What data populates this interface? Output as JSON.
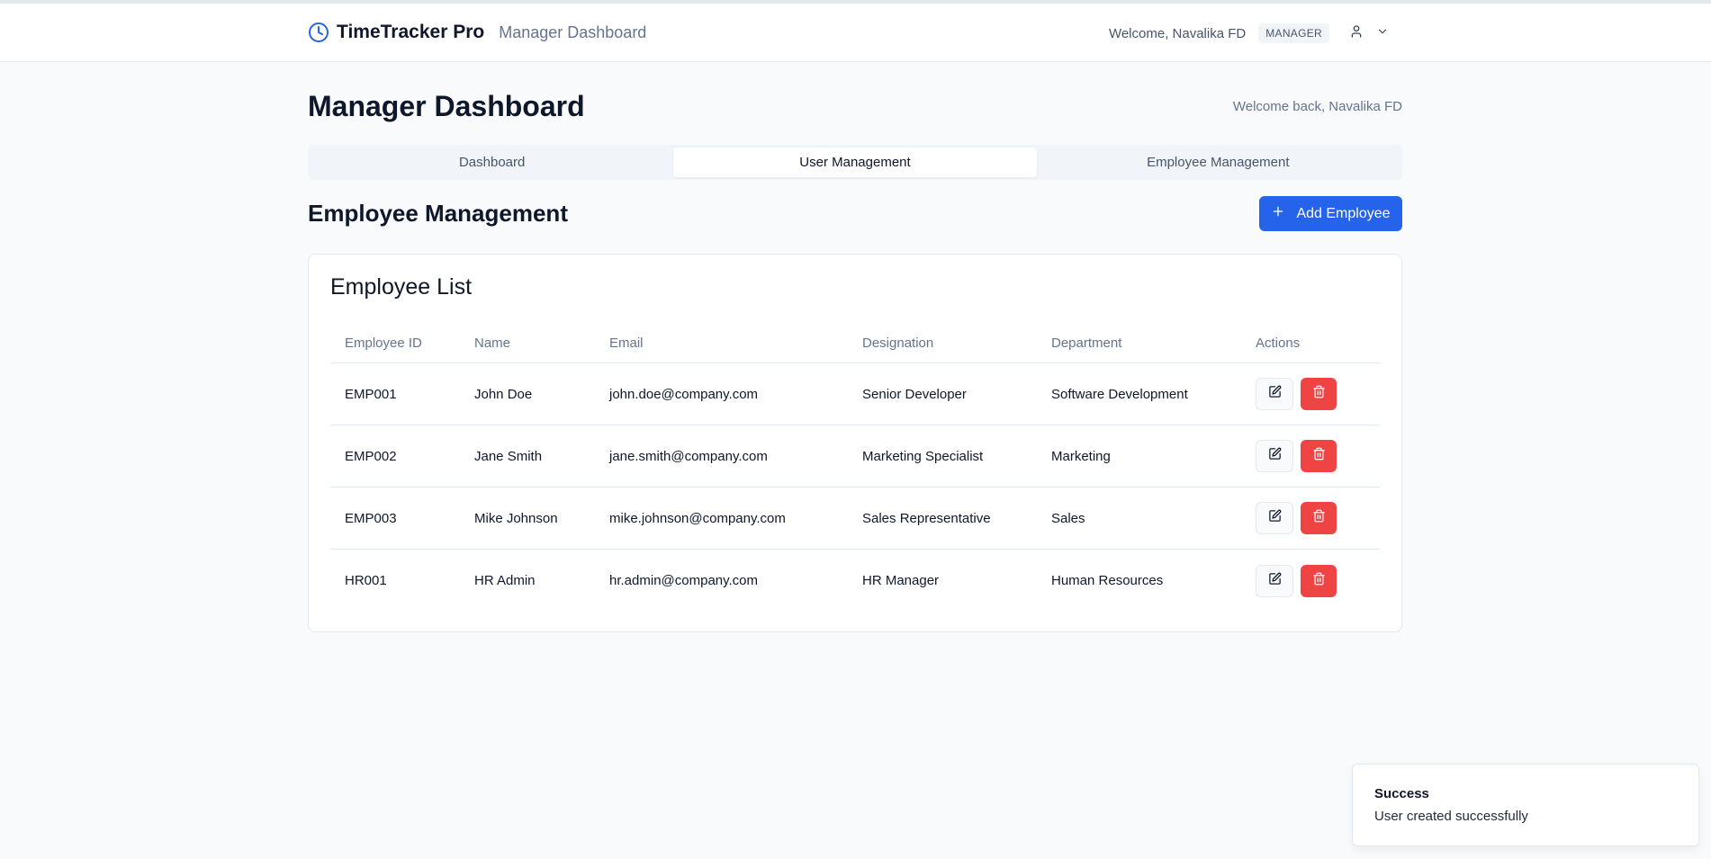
{
  "header": {
    "app_name": "TimeTracker Pro",
    "subtitle": "Manager Dashboard",
    "welcome": "Welcome, Navalika FD",
    "role": "MANAGER",
    "icons": {
      "brand": "clock-icon",
      "user": "user-icon",
      "menu": "chevron-down-icon"
    }
  },
  "page": {
    "title": "Manager Dashboard",
    "welcome_back": "Welcome back, Navalika FD"
  },
  "tabs": [
    {
      "label": "Dashboard",
      "active": false
    },
    {
      "label": "User Management",
      "active": true
    },
    {
      "label": "Employee Management",
      "active": false
    }
  ],
  "section": {
    "title": "Employee Management",
    "add_button": "Add Employee"
  },
  "card": {
    "title": "Employee List",
    "columns": [
      "Employee ID",
      "Name",
      "Email",
      "Designation",
      "Department",
      "Actions"
    ],
    "rows": [
      {
        "id": "EMP001",
        "name": "John Doe",
        "email": "john.doe@company.com",
        "designation": "Senior Developer",
        "department": "Software Development"
      },
      {
        "id": "EMP002",
        "name": "Jane Smith",
        "email": "jane.smith@company.com",
        "designation": "Marketing Specialist",
        "department": "Marketing"
      },
      {
        "id": "EMP003",
        "name": "Mike Johnson",
        "email": "mike.johnson@company.com",
        "designation": "Sales Representative",
        "department": "Sales"
      },
      {
        "id": "HR001",
        "name": "HR Admin",
        "email": "hr.admin@company.com",
        "designation": "HR Manager",
        "department": "Human Resources"
      }
    ]
  },
  "toast": {
    "title": "Success",
    "message": "User created successfully"
  },
  "colors": {
    "accent": "#2563eb",
    "danger": "#ef4444",
    "background": "#f8fafc"
  }
}
